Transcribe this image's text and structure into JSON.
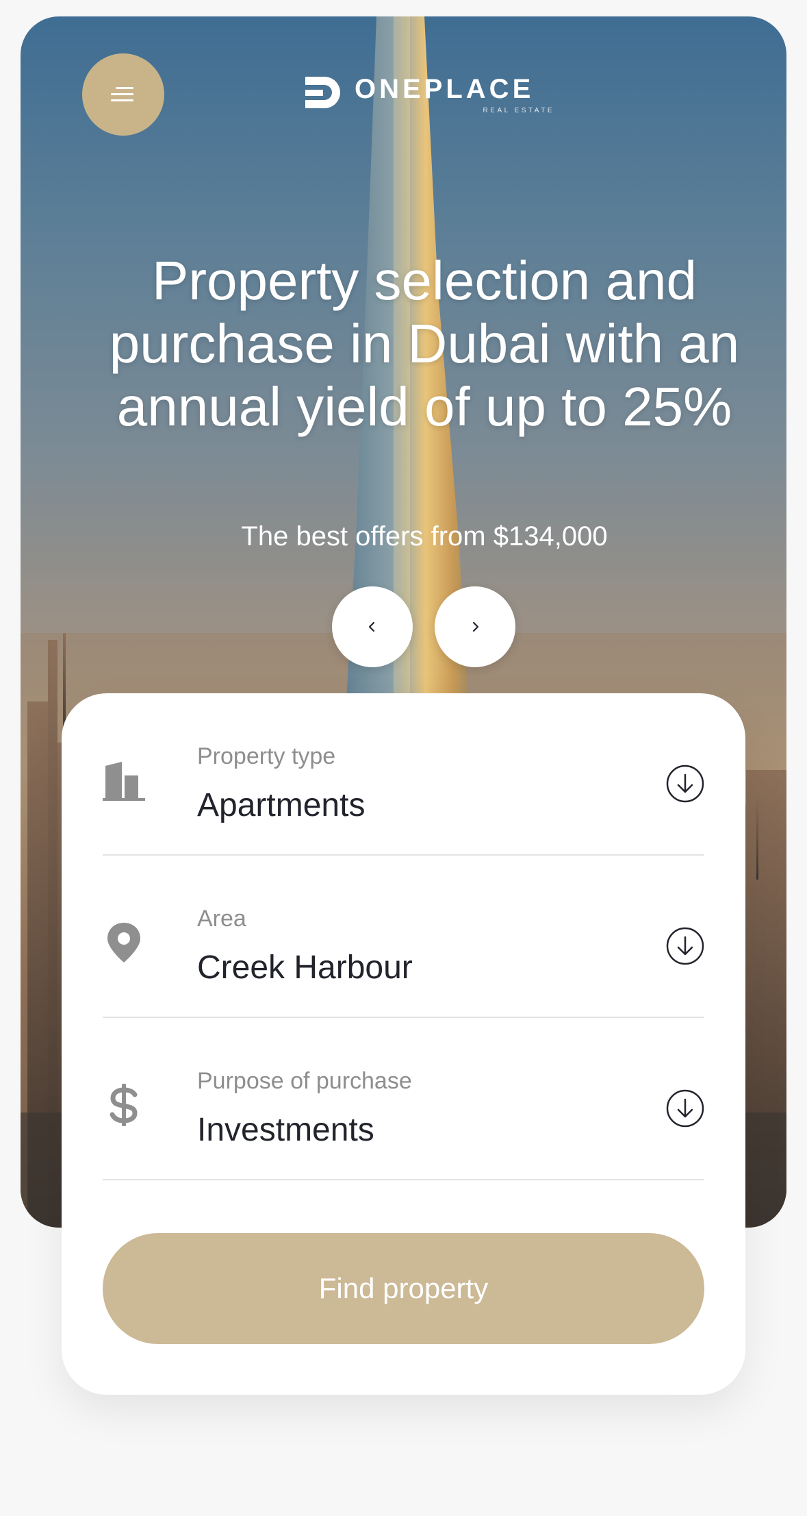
{
  "brand": {
    "name": "ONEPLACE",
    "tagline": "REAL ESTATE"
  },
  "colors": {
    "accent": "#c9b48a",
    "button": "#ccb995",
    "text_dark": "#22242c",
    "text_muted": "#8e8e8e"
  },
  "hero": {
    "headline": "Property selection and purchase in Dubai with an annual yield of up to 25%",
    "subline": "The best offers from $134,000"
  },
  "icons": {
    "menu": "menu-icon",
    "prev": "chevron-left-icon",
    "next": "chevron-right-icon",
    "property_type": "building-icon",
    "area": "map-pin-icon",
    "purpose": "dollar-icon",
    "dropdown": "arrow-down-circle-icon"
  },
  "search": {
    "fields": [
      {
        "label": "Property type",
        "value": "Apartments"
      },
      {
        "label": "Area",
        "value": "Creek Harbour"
      },
      {
        "label": "Purpose of purchase",
        "value": "Investments"
      }
    ],
    "submit_label": "Find property"
  }
}
